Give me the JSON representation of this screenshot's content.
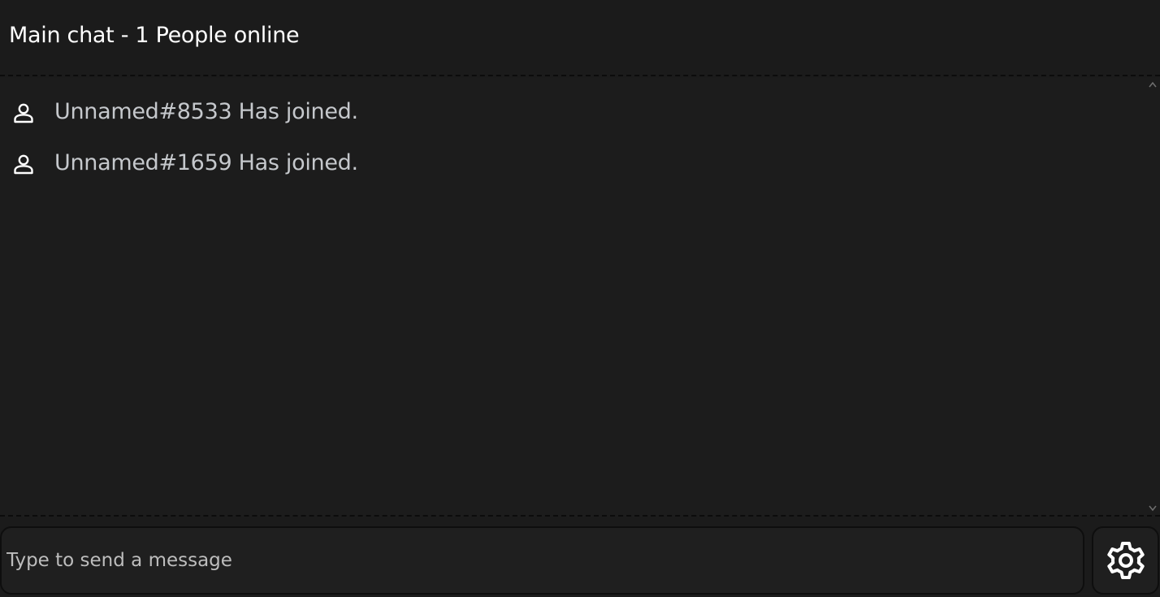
{
  "header": {
    "title": "Main chat - 1 People online"
  },
  "messages": [
    {
      "icon": "person-icon",
      "text": "Unnamed#8533 Has joined."
    },
    {
      "icon": "person-icon",
      "text": "Unnamed#1659 Has joined."
    }
  ],
  "composer": {
    "placeholder": "Type to send a message",
    "value": ""
  },
  "settings": {
    "icon": "gear-icon"
  },
  "colors": {
    "background": "#1b1b1b",
    "message_text": "#c5c8cc",
    "title_text": "#ffffff",
    "icon": "#ffffff"
  }
}
